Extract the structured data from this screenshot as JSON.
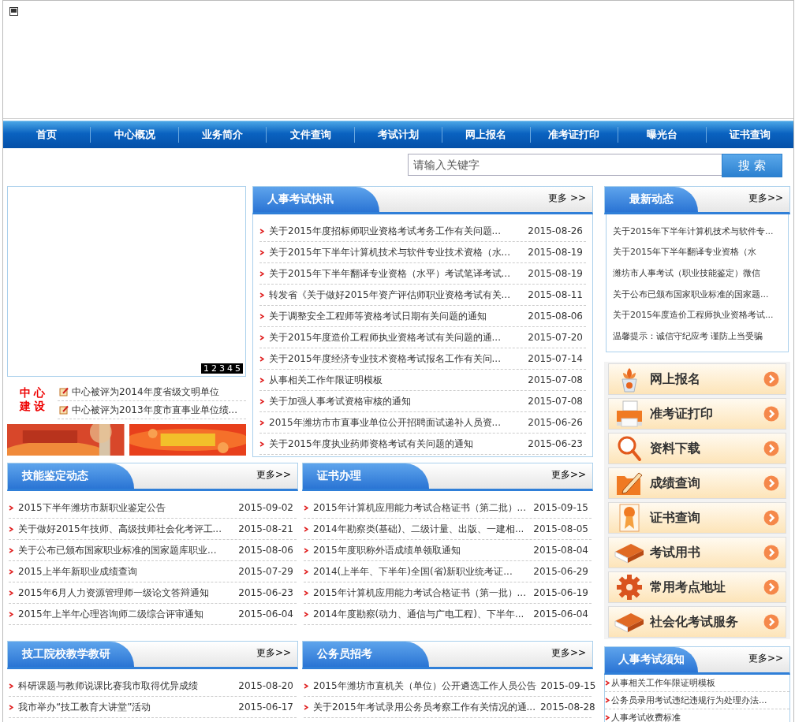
{
  "nav": {
    "items": [
      "首页",
      "中心概况",
      "业务简介",
      "文件查询",
      "考试计划",
      "网上报名",
      "准考证打印",
      "曝光台",
      "证书查询"
    ]
  },
  "search": {
    "placeholder": "请输入关键字",
    "button": "搜 索"
  },
  "slideshow": {
    "pager": [
      "1",
      "2",
      "3",
      "4",
      "5"
    ]
  },
  "center_building": {
    "label_lines": [
      "中 心",
      "建 设"
    ],
    "items": [
      "中心被评为2014年度省级文明单位",
      "中心被评为2013年度市直事业单位绩..."
    ]
  },
  "exam_news": {
    "title": "人事考试快讯",
    "more": "更多 >>",
    "items": [
      {
        "title": "关于2015年度招标师职业资格考试考务工作有关问题...",
        "date": "2015-08-26"
      },
      {
        "title": "关于2015年下半年计算机技术与软件专业技术资格（水...",
        "date": "2015-08-19"
      },
      {
        "title": "关于2015年下半年翻译专业资格（水平）考试笔译考试...",
        "date": "2015-08-19"
      },
      {
        "title": "转发省《关于做好2015年资产评估师职业资格考试有关...",
        "date": "2015-08-11"
      },
      {
        "title": "关于调整安全工程师等资格考试日期有关问题的通知",
        "date": "2015-08-06"
      },
      {
        "title": "关于2015年度造价工程师执业资格考试有关问题的通...",
        "date": "2015-07-20"
      },
      {
        "title": "关于2015年度经济专业技术资格考试报名工作有关问...",
        "date": "2015-07-14"
      },
      {
        "title": "从事相关工作年限证明模板",
        "date": "2015-07-08"
      },
      {
        "title": "关于加强人事考试资格审核的通知",
        "date": "2015-07-08"
      },
      {
        "title": "2015年潍坊市市直事业单位公开招聘面试递补人员资...",
        "date": "2015-06-26"
      },
      {
        "title": "关于2015年度执业药师资格考试有关问题的通知",
        "date": "2015-06-23"
      }
    ]
  },
  "latest": {
    "title": "最新动态",
    "more": "更多>>",
    "items": [
      "关于2015年下半年计算机技术与软件专...",
      "关于2015年下半年翻译专业资格（水",
      "潍坊市人事考试（职业技能鉴定）微信",
      "关于公布已颁布国家职业标准的国家题...",
      "关于2015年度造价工程师执业资格考试...",
      "温馨提示：诚信守纪应考 谨防上当受骗"
    ]
  },
  "quick_links": [
    {
      "label": "网上报名",
      "kind": "plant"
    },
    {
      "label": "准考证打印",
      "kind": "printer"
    },
    {
      "label": "资料下载",
      "kind": "magnifier"
    },
    {
      "label": "成绩查询",
      "kind": "folder"
    },
    {
      "label": "证书查询",
      "kind": "ribbon"
    },
    {
      "label": "考试用书",
      "kind": "book"
    },
    {
      "label": "常用考点地址",
      "kind": "gear"
    },
    {
      "label": "社会化考试服务",
      "kind": "book"
    }
  ],
  "lower_sections": [
    {
      "title": "技能鉴定动态",
      "more": "更多>>",
      "items": [
        {
          "title": "2015下半年潍坊市新职业鉴定公告",
          "date": "2015-09-02"
        },
        {
          "title": "关于做好2015年技师、高级技师社会化考评工...",
          "date": "2015-08-21"
        },
        {
          "title": "关于公布已颁布国家职业标准的国家题库职业...",
          "date": "2015-08-06"
        },
        {
          "title": "2015上半年新职业成绩查询",
          "date": "2015-07-29"
        },
        {
          "title": "2015年6月人力资源管理师一级论文答辩通知",
          "date": "2015-06-23"
        },
        {
          "title": "2015年上半年心理咨询师二级综合评审通知",
          "date": "2015-06-04"
        }
      ]
    },
    {
      "title": "证书办理",
      "more": "更多>>",
      "items": [
        {
          "title": "2015年计算机应用能力考试合格证书（第二批）...",
          "date": "2015-09-15"
        },
        {
          "title": "2014年勘察类(基础)、二级计量、出版、一建相...",
          "date": "2015-08-05"
        },
        {
          "title": "2015年度职称外语成绩单领取通知",
          "date": "2015-08-04"
        },
        {
          "title": "2014(上半年、下半年)全国(省)新职业统考证...",
          "date": "2015-06-29"
        },
        {
          "title": "2015年计算机应用能力考试合格证书（第一批）...",
          "date": "2015-06-19"
        },
        {
          "title": "2014年度勘察(动力、通信与广电工程)、下半年...",
          "date": "2015-06-04"
        }
      ]
    },
    {
      "title": "技工院校教学教研",
      "more": "更多>>",
      "items": [
        {
          "title": "科研课题与教师说课比赛我市取得优异成绩",
          "date": "2015-08-20"
        },
        {
          "title": "我市举办“技工教育大讲堂”活动",
          "date": "2015-06-17"
        }
      ]
    },
    {
      "title": "公务员招考",
      "more": "更多>>",
      "items": [
        {
          "title": "2015年潍坊市直机关（单位）公开遴选工作人员公告",
          "date": "2015-09-15"
        },
        {
          "title": "关于2015年考试录用公务员考察工作有关情况的通...",
          "date": "2015-08-28"
        }
      ]
    }
  ],
  "notice": {
    "title": "人事考试须知",
    "more": "更多>>",
    "items": [
      "从事相关工作年限证明模板",
      "公务员录用考试违纪违规行为处理办法...",
      "人事考试收费标准"
    ]
  }
}
